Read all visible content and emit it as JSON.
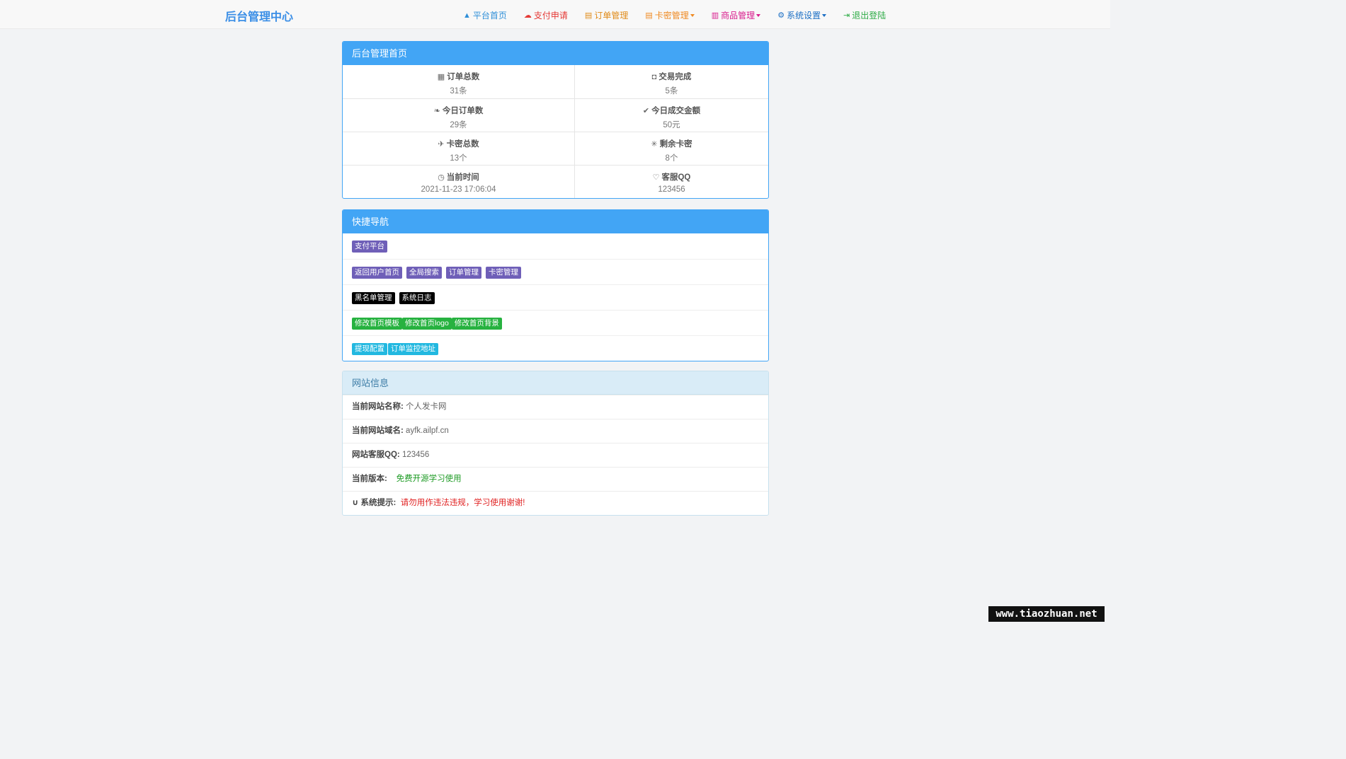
{
  "brand": "后台管理中心",
  "colors": {
    "brand": "#3a8ee6",
    "panel_primary": "#42a5f5",
    "panel_info": "#d9ecf7",
    "tag_purple": "#6f5fb8",
    "tag_black": "#000000",
    "tag_green": "#27b240",
    "tag_cyan": "#22b8e0"
  },
  "nav": [
    {
      "label": "平台首页",
      "icon": "user-icon",
      "color": "#2f8fd8",
      "dropdown": false
    },
    {
      "label": "支付申请",
      "icon": "cloud-icon",
      "color": "#e53935",
      "dropdown": false
    },
    {
      "label": "订单管理",
      "icon": "calendar-icon",
      "color": "#e08b1a",
      "dropdown": false
    },
    {
      "label": "卡密管理",
      "icon": "list-icon",
      "color": "#ef8a22",
      "dropdown": true
    },
    {
      "label": "商品管理",
      "icon": "book-icon",
      "color": "#d81b8c",
      "dropdown": true
    },
    {
      "label": "系统设置",
      "icon": "gear-icon",
      "color": "#1c6fc4",
      "dropdown": true
    },
    {
      "label": "退出登陆",
      "icon": "logout-icon",
      "color": "#2eab46",
      "dropdown": false
    }
  ],
  "home_panel": {
    "title": "后台管理首页",
    "stats": [
      {
        "label": "订单总数",
        "value": "31条",
        "icon": "grid-icon"
      },
      {
        "label": "交易完成",
        "value": "5条",
        "icon": "cart-icon"
      },
      {
        "label": "今日订单数",
        "value": "29条",
        "icon": "leaf-icon"
      },
      {
        "label": "今日成交金额",
        "value": "50元",
        "icon": "check-icon"
      },
      {
        "label": "卡密总数",
        "value": "13个",
        "icon": "plane-icon"
      },
      {
        "label": "剩余卡密",
        "value": "8个",
        "icon": "asterisk-icon"
      },
      {
        "label": "当前时间",
        "value": "2021-11-23 17:06:04",
        "icon": "clock-icon"
      },
      {
        "label": "客服QQ",
        "value": "123456",
        "icon": "heart-icon"
      }
    ]
  },
  "quick_nav": {
    "title": "快捷导航",
    "rows": [
      [
        {
          "label": "支付平台",
          "style": "purple"
        }
      ],
      [
        {
          "label": "返回用户首页",
          "style": "purple"
        },
        {
          "label": "全局搜索",
          "style": "purple"
        },
        {
          "label": "订单管理",
          "style": "purple"
        },
        {
          "label": "卡密管理",
          "style": "purple"
        }
      ],
      [
        {
          "label": "黑名单管理",
          "style": "black"
        },
        {
          "label": "系统日志",
          "style": "black"
        }
      ],
      [
        {
          "label": "修改首页模板",
          "style": "green"
        },
        {
          "label": "修改首页logo",
          "style": "green"
        },
        {
          "label": "修改首页背景",
          "style": "green"
        }
      ],
      [
        {
          "label": "提现配置",
          "style": "cyan"
        },
        {
          "label": "订单监控地址",
          "style": "cyan"
        }
      ]
    ]
  },
  "site_info": {
    "title": "网站信息",
    "name_label": "当前网站名称:",
    "name_value": "个人发卡网",
    "domain_label": "当前网站域名:",
    "domain_value": "ayfk.ailpf.cn",
    "qq_label": "网站客服QQ:",
    "qq_value": "123456",
    "version_label": "当前版本:",
    "version_value": "免费开源学习使用",
    "tip_label": "系统提示:",
    "tip_value": "请勿用作违法违规，学习使用谢谢!"
  },
  "watermark": "www.tiaozhuan.net"
}
